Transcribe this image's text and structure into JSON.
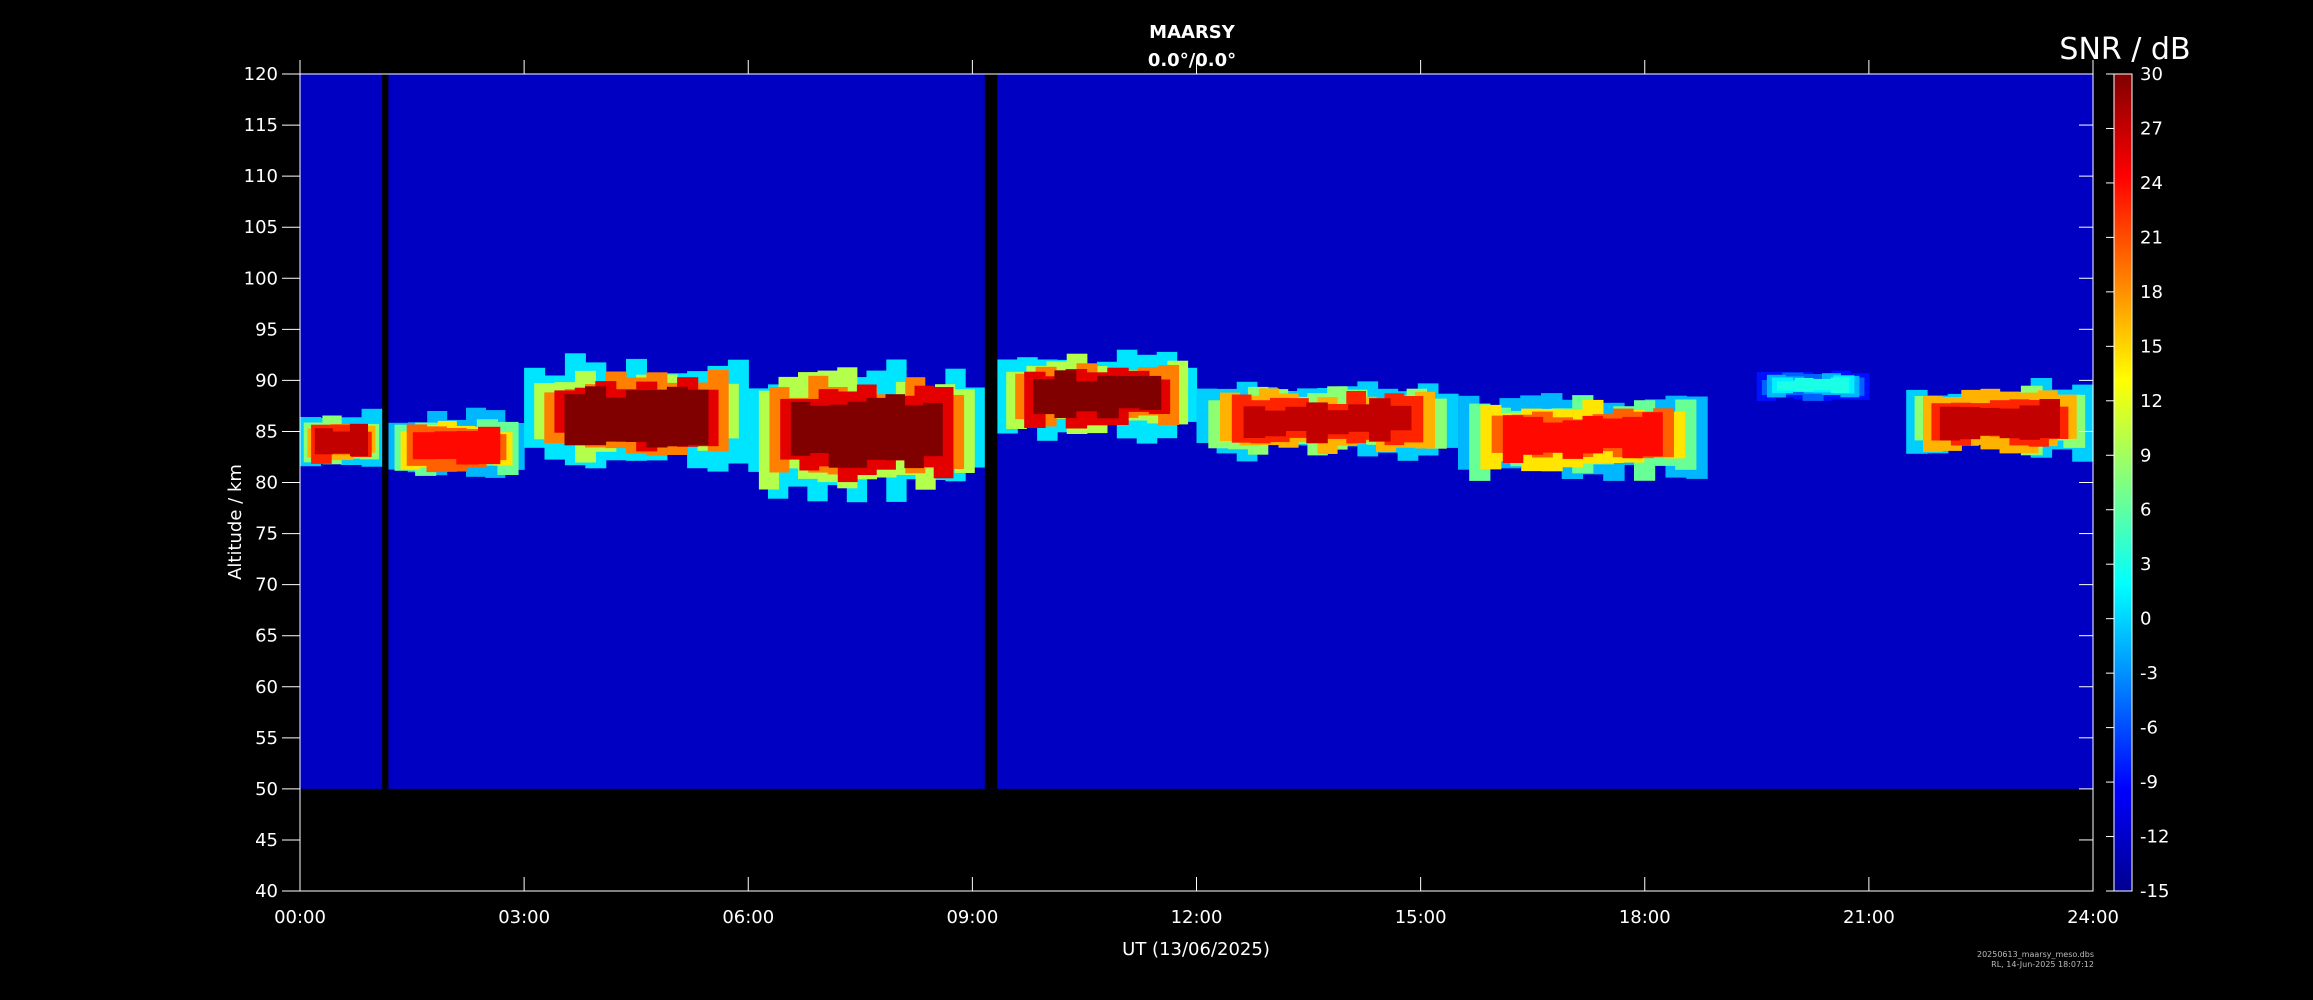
{
  "chart_data": {
    "type": "heatmap",
    "title": "MAARSY",
    "subtitle": "0.0°/0.0°",
    "xlabel": "UT (13/06/2025)",
    "ylabel": "Altitude / km",
    "xlim": [
      "00:00",
      "24:00"
    ],
    "ylim": [
      40,
      120
    ],
    "x_ticks": [
      "00:00",
      "03:00",
      "06:00",
      "09:00",
      "12:00",
      "15:00",
      "18:00",
      "21:00",
      "24:00"
    ],
    "y_ticks": [
      40,
      45,
      50,
      55,
      60,
      65,
      70,
      75,
      80,
      85,
      90,
      95,
      100,
      105,
      110,
      115,
      120
    ],
    "data_altitude_range": [
      50,
      120
    ],
    "colorbar": {
      "label": "SNR / dB",
      "range": [
        -15,
        30
      ],
      "ticks": [
        -15,
        -12,
        -9,
        -6,
        -3,
        0,
        3,
        6,
        9,
        12,
        15,
        18,
        21,
        24,
        27,
        30
      ],
      "colormap": "jet"
    },
    "background_snr": -12,
    "data_gaps_ut": [
      [
        "01:06",
        "01:11"
      ],
      [
        "09:10",
        "09:20"
      ]
    ],
    "echo_regions": [
      {
        "start": "00:00",
        "end": "01:06",
        "alt_bottom": 81,
        "alt_top": 87,
        "peak_snr": 27
      },
      {
        "start": "01:11",
        "end": "03:00",
        "alt_bottom": 80,
        "alt_top": 87,
        "peak_snr": 24
      },
      {
        "start": "03:00",
        "end": "06:00",
        "alt_bottom": 81,
        "alt_top": 92,
        "peak_snr": 30
      },
      {
        "start": "06:00",
        "end": "09:10",
        "alt_bottom": 78,
        "alt_top": 92,
        "peak_snr": 30
      },
      {
        "start": "09:20",
        "end": "12:00",
        "alt_bottom": 84,
        "alt_top": 93,
        "peak_snr": 30
      },
      {
        "start": "12:00",
        "end": "15:30",
        "alt_bottom": 82,
        "alt_top": 90,
        "peak_snr": 27
      },
      {
        "start": "15:30",
        "end": "18:50",
        "alt_bottom": 80,
        "alt_top": 89,
        "peak_snr": 24
      },
      {
        "start": "19:30",
        "end": "21:00",
        "alt_bottom": 88,
        "alt_top": 91,
        "peak_snr": 3
      },
      {
        "start": "21:30",
        "end": "24:00",
        "alt_bottom": 82,
        "alt_top": 90,
        "peak_snr": 27
      }
    ]
  },
  "footer": {
    "filename": "20250613_maarsy_meso.dbs",
    "stamp": "RL, 14-Jun-2025 18:07:12"
  },
  "colors": {
    "background": "#000000",
    "axes": "#ffffff",
    "field_low": "#00008f",
    "data_gap": "#000000"
  }
}
